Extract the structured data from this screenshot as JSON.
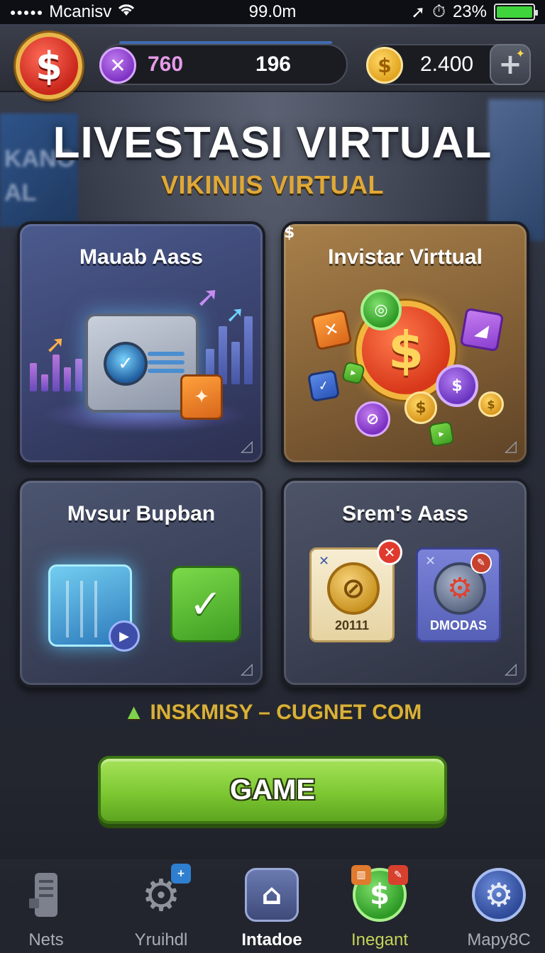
{
  "status_bar": {
    "carrier": "Mcanisv",
    "center": "99.0m",
    "battery": "23%"
  },
  "hud": {
    "xp_value": "760",
    "xp_value_secondary": "196",
    "coins": "2.400",
    "plus_label": "+"
  },
  "title": "LIVESTASI VIRTUAL",
  "subtitle": "VIKINIIS VIRTUAL",
  "cards": [
    {
      "title": "Mauab Aass"
    },
    {
      "title": "Invistar Virttual"
    },
    {
      "title": "Mvsur Bupban"
    },
    {
      "title": "Srem's Aass",
      "items": [
        "20111",
        "DMODAS"
      ]
    }
  ],
  "tagline": "INSKMISY – CUGNET COM",
  "game_button": "GAME",
  "nav": [
    {
      "label": "Nets"
    },
    {
      "label": "Yruihdl"
    },
    {
      "label": "Intadoe",
      "active": true
    },
    {
      "label": "Inegant"
    },
    {
      "label": "Mapy8C"
    }
  ],
  "colors": {
    "accent_gold": "#e0a836",
    "game_button_green": "#7dc832",
    "xp_purple": "#7a2fc0",
    "coin_gold": "#e0a11d"
  }
}
